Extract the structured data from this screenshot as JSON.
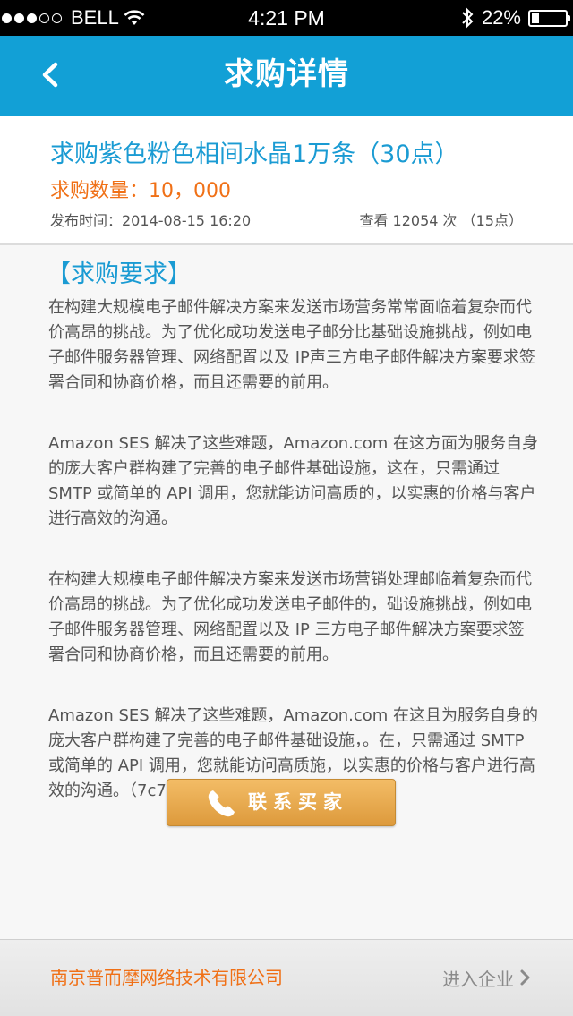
{
  "status_bar": {
    "carrier": "BELL",
    "time": "4:21 PM",
    "battery": "22%",
    "signal_bars": 3,
    "battery_level": 0.22
  },
  "navbar": {
    "title": "求购详情"
  },
  "listing": {
    "title": "求购紫色粉色相间水晶1万条（30点）",
    "quantity": "求购数量：10，000",
    "publish_time": "发布时间：2014-08-15  16:20",
    "views": "查看 12054 次 （15点）"
  },
  "requirements": {
    "heading": "【求购要求】",
    "paragraphs": [
      "在构建大规模电子邮件解决方案来发送市场营务常常面临着复杂而代价高昂的挑战。为了优化成功发送电子邮分比基础设施挑战，例如电子邮件服务器管理、网络配置以及 IP声三方电子邮件解决方案要求签署合同和协商价格，而且还需要的前用。",
      "Amazon SES 解决了这些难题，Amazon.com 在这方面为服务自身的庞大客户群构建了完善的电子邮件基础设施，这在，只需通过 SMTP 或简单的 API 调用，您就能访问高质的，以实惠的价格与客户进行高效的沟通。",
      "在构建大规模电子邮件解决方案来发送市场营销处理邮临着复杂而代价高昂的挑战。为了优化成功发送电子邮件的，础设施挑战，例如电子邮件服务器管理、网络配置以及 IP 三方电子邮件解决方案要求签署合同和协商价格，而且还需要的前用。",
      "Amazon SES 解决了这些难题，Amazon.com 在这且为服务自身的庞大客户群构建了完善的电子邮件基础设施，。在，只需通过 SMTP 或简单的 API 调用，您就能访问高质施，以实惠的价格与客户进行高效的沟通。（7c7c7c 18点）"
    ]
  },
  "contact_button": {
    "label": "联系买家",
    "icon": "phone-icon"
  },
  "footer": {
    "company": "南京普而摩网络技术有限公司",
    "enter_label": "进入企业",
    "icon": "chevron-right-icon"
  },
  "colors": {
    "navbar": "#12a0d6",
    "title_blue": "#1a9bd3",
    "orange": "#f07016",
    "body_text": "#555555",
    "button_gold": "#e6a64a"
  }
}
